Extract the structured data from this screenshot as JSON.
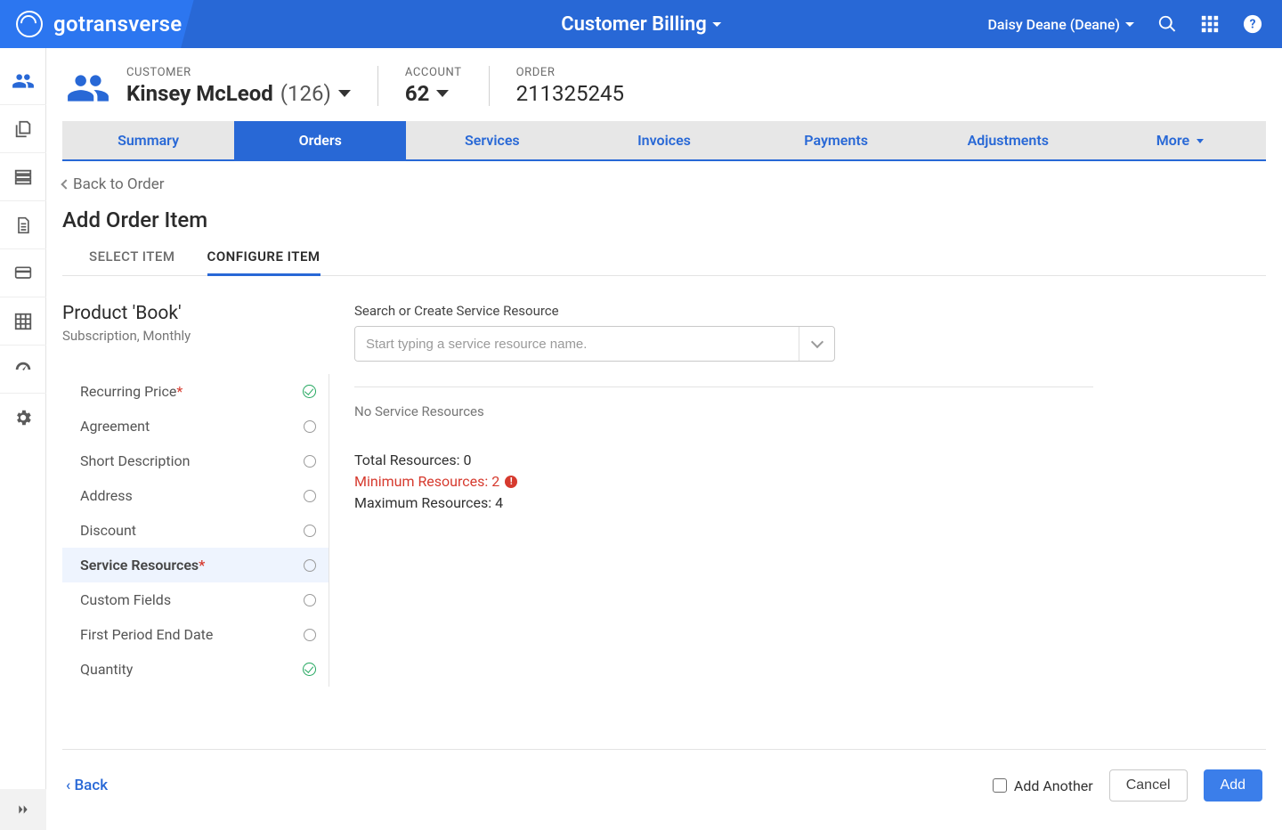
{
  "header": {
    "brand": "gotransverse",
    "title": "Customer Billing",
    "user": "Daisy Deane (Deane)"
  },
  "breadcrumb": {
    "customer_label": "CUSTOMER",
    "customer_name": "Kinsey McLeod",
    "customer_id": "(126)",
    "account_label": "ACCOUNT",
    "account_value": "62",
    "order_label": "ORDER",
    "order_value": "211325245"
  },
  "tabs": [
    "Summary",
    "Orders",
    "Services",
    "Invoices",
    "Payments",
    "Adjustments",
    "More"
  ],
  "active_tab": "Orders",
  "back_link": "Back to Order",
  "page_title": "Add Order Item",
  "subtabs": [
    "SELECT ITEM",
    "CONFIGURE ITEM"
  ],
  "active_subtab": "CONFIGURE ITEM",
  "product": {
    "title": "Product 'Book'",
    "meta": "Subscription, Monthly"
  },
  "options": [
    {
      "label": "Recurring Price",
      "required": true,
      "status": "check"
    },
    {
      "label": "Agreement",
      "required": false,
      "status": "empty"
    },
    {
      "label": "Short Description",
      "required": false,
      "status": "empty"
    },
    {
      "label": "Address",
      "required": false,
      "status": "empty"
    },
    {
      "label": "Discount",
      "required": false,
      "status": "empty"
    },
    {
      "label": "Service Resources",
      "required": true,
      "status": "empty",
      "active": true
    },
    {
      "label": "Custom Fields",
      "required": false,
      "status": "empty"
    },
    {
      "label": "First Period End Date",
      "required": false,
      "status": "empty"
    },
    {
      "label": "Quantity",
      "required": false,
      "status": "check"
    }
  ],
  "panel": {
    "field_label": "Search or Create Service Resource",
    "placeholder": "Start typing a service resource name.",
    "empty_msg": "No Service Resources",
    "total_label": "Total Resources:",
    "total_value": "0",
    "min_label": "Minimum Resources:",
    "min_value": "2",
    "max_label": "Maximum Resources:",
    "max_value": "4"
  },
  "footer": {
    "back": "Back",
    "add_another": "Add Another",
    "cancel": "Cancel",
    "add": "Add"
  }
}
